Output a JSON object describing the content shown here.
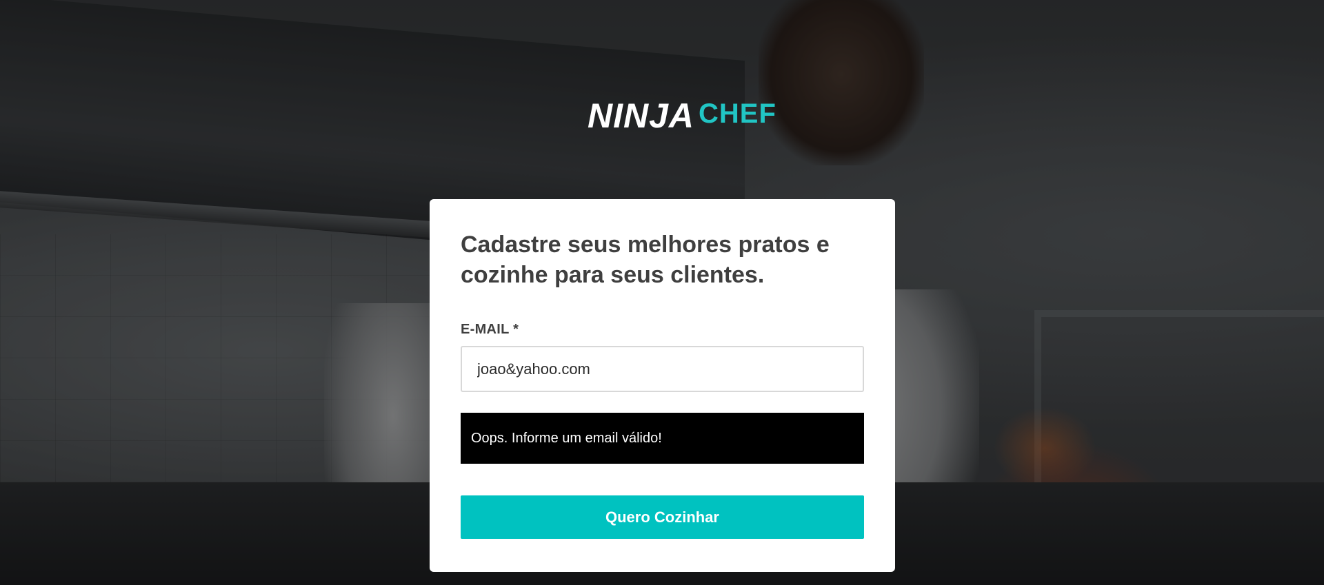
{
  "brand": {
    "logo_part1": "NINJA",
    "logo_part2": "CHEF",
    "accent_color": "#00c2c0"
  },
  "form": {
    "title": "Cadastre seus melhores pratos e cozinhe para seus clientes.",
    "email_label": "E-MAIL *",
    "email_value": "joao&yahoo.com",
    "error_message": "Oops. Informe um email válido!",
    "submit_label": "Quero Cozinhar"
  }
}
